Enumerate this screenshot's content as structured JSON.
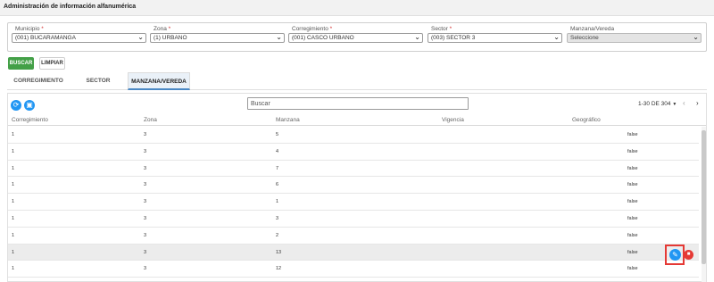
{
  "page": {
    "title": "Administración de información alfanumérica"
  },
  "filters": {
    "municipio": {
      "label": "Municipio",
      "value": "(001) BUCARAMANGA"
    },
    "zona": {
      "label": "Zona",
      "value": "(1) URBANO"
    },
    "corregimiento": {
      "label": "Corregimiento",
      "value": "(001) CASCO URBANO"
    },
    "sector": {
      "label": "Sector",
      "value": "(003) SECTOR 3"
    },
    "manzana": {
      "label": "Manzana/Vereda",
      "value": "Seleccione"
    }
  },
  "actions": {
    "buscar": "BUSCAR",
    "limpiar": "LIMPIAR"
  },
  "tabs": [
    {
      "label": "CORREGIMIENTO",
      "active": false
    },
    {
      "label": "SECTOR",
      "active": false
    },
    {
      "label": "MANZANA/VEREDA",
      "active": true
    }
  ],
  "table": {
    "search_placeholder": "Buscar",
    "pager": "1-30 DE 304",
    "columns": [
      "Corregimiento",
      "Zona",
      "Manzana",
      "Vigencia",
      "Geográfico"
    ],
    "rows": [
      [
        "1",
        "3",
        "5",
        "",
        "false"
      ],
      [
        "1",
        "3",
        "4",
        "",
        "false"
      ],
      [
        "1",
        "3",
        "7",
        "",
        "false"
      ],
      [
        "1",
        "3",
        "6",
        "",
        "false"
      ],
      [
        "1",
        "3",
        "1",
        "",
        "false"
      ],
      [
        "1",
        "3",
        "3",
        "",
        "false"
      ],
      [
        "1",
        "3",
        "2",
        "",
        "false"
      ],
      [
        "1",
        "3",
        "13",
        "",
        "false"
      ],
      [
        "1",
        "3",
        "12",
        "",
        "false"
      ]
    ]
  },
  "icons": {
    "refresh": "refresh-icon",
    "save": "save-icon",
    "edit": "pencil-icon",
    "delete": "trash-icon"
  },
  "colors": {
    "primary": "#2196f3",
    "success": "#43a047",
    "danger": "#e53935",
    "required": "#d32f2f"
  }
}
